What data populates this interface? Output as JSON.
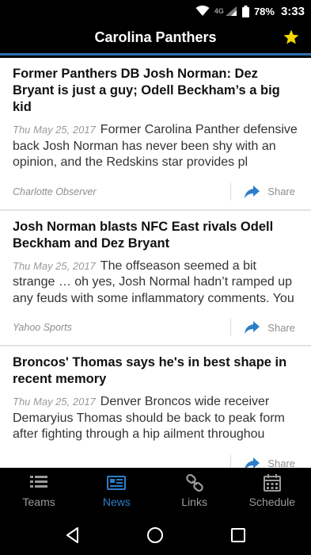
{
  "status_bar": {
    "network": "4G",
    "battery": "78%",
    "time": "3:33"
  },
  "app_bar": {
    "title": "Carolina Panthers"
  },
  "articles": [
    {
      "title": "Former Panthers DB Josh Norman: Dez Bryant is just a guy; Odell Beckham’s a big kid",
      "date": "Thu May 25, 2017",
      "summary": "Former Carolina Panther defensive back Josh Norman has never been shy with an opinion, and the Redskins star provides pl",
      "source": "Charlotte Observer",
      "share_label": "Share"
    },
    {
      "title": "Josh Norman blasts NFC East rivals Odell Beckham and Dez Bryant",
      "date": "Thu May 25, 2017",
      "summary": "The offseason seemed a bit strange … oh yes, Josh Normal hadn’t ramped up any feuds with some inflammatory comments. You",
      "source": "Yahoo Sports",
      "share_label": "Share"
    },
    {
      "title": "Broncos' Thomas says he's in best shape in recent memory",
      "date": "Thu May 25, 2017",
      "summary": "Denver Broncos wide receiver Demaryius Thomas should be back to peak form after fighting through a hip ailment throughou",
      "source": "",
      "share_label": "Share"
    }
  ],
  "bottom_nav": {
    "items": [
      {
        "label": "Teams",
        "icon": "list-icon",
        "active": false
      },
      {
        "label": "News",
        "icon": "newspaper-icon",
        "active": true
      },
      {
        "label": "Links",
        "icon": "link-icon",
        "active": false
      },
      {
        "label": "Schedule",
        "icon": "calendar-icon",
        "active": false
      }
    ]
  },
  "colors": {
    "accent": "#2e7ec7",
    "star": "#f5d800",
    "header_bg": "#000000"
  }
}
